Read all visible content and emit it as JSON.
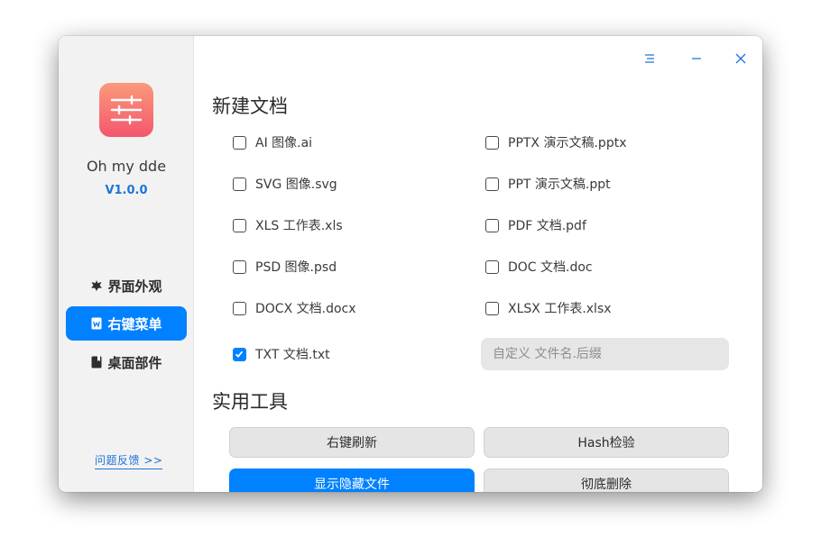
{
  "app": {
    "name": "Oh my dde",
    "version": "V1.0.0"
  },
  "sidebar": {
    "items": [
      {
        "label": "界面外观",
        "icon": "bug-icon",
        "active": false
      },
      {
        "label": "右键菜单",
        "icon": "word-doc-icon",
        "active": true
      },
      {
        "label": "桌面部件",
        "icon": "book-icon",
        "active": false
      }
    ],
    "feedback": "问题反馈  >>"
  },
  "titlebar": {
    "buttons": [
      "menu-icon",
      "minimize-icon",
      "close-icon"
    ]
  },
  "new_document": {
    "title": "新建文档",
    "options": [
      {
        "label": "AI 图像.ai",
        "checked": false
      },
      {
        "label": "PPTX 演示文稿.pptx",
        "checked": false
      },
      {
        "label": "SVG 图像.svg",
        "checked": false
      },
      {
        "label": "PPT 演示文稿.ppt",
        "checked": false
      },
      {
        "label": "XLS 工作表.xls",
        "checked": false
      },
      {
        "label": "PDF 文档.pdf",
        "checked": false
      },
      {
        "label": "PSD 图像.psd",
        "checked": false
      },
      {
        "label": "DOC 文档.doc",
        "checked": false
      },
      {
        "label": "DOCX 文档.docx",
        "checked": false
      },
      {
        "label": "XLSX 工作表.xlsx",
        "checked": false
      },
      {
        "label": "TXT 文档.txt",
        "checked": true
      }
    ],
    "custom_suffix_placeholder": "自定义 文件名.后缀"
  },
  "tools": {
    "title": "实用工具",
    "buttons": [
      {
        "label": "右键刷新",
        "primary": false
      },
      {
        "label": "Hash检验",
        "primary": false
      },
      {
        "label": "显示隐藏文件",
        "primary": true
      },
      {
        "label": "彻底删除",
        "primary": false
      }
    ]
  },
  "colors": {
    "accent": "#0081ff",
    "link": "#1e74d6",
    "sidebar_bg": "#f2f2f2",
    "logo_top": "#fb9a7a",
    "logo_bottom": "#f4566e"
  }
}
